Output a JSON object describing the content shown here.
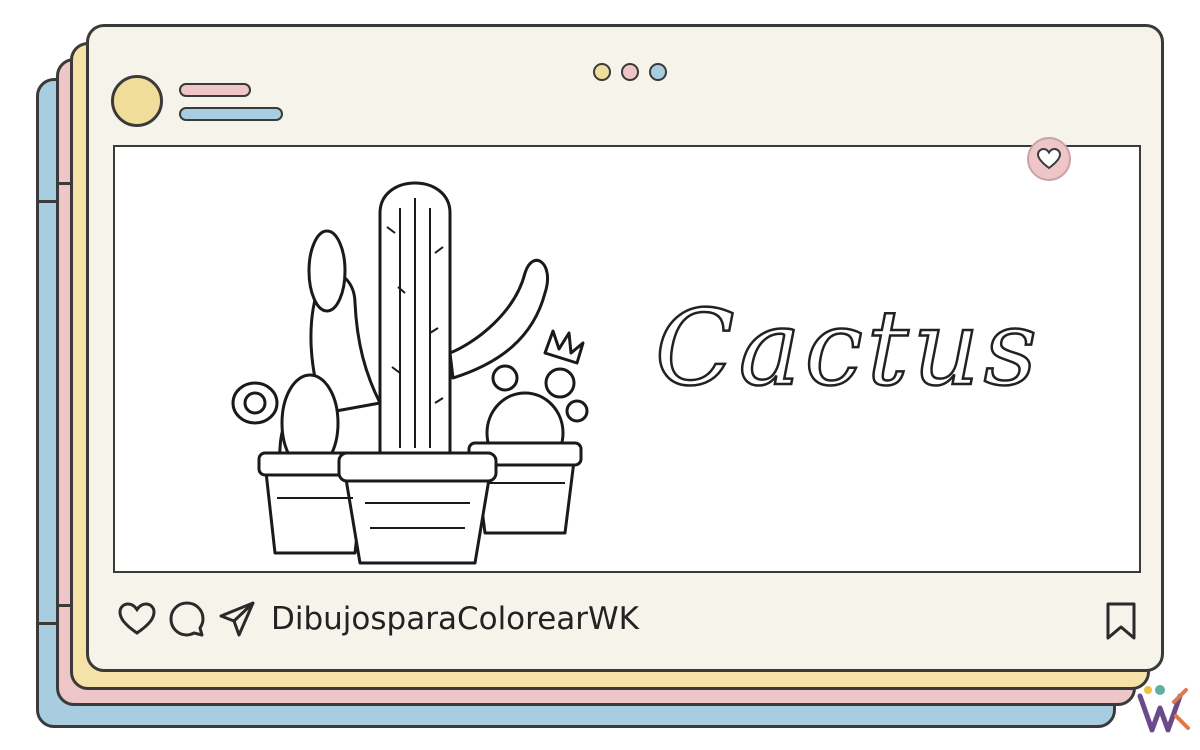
{
  "post": {
    "username": "DibujosparaColorearWK",
    "title_word": "Cactus"
  },
  "window_dots": [
    "#f1dd9a",
    "#efc6c8",
    "#a9cde0"
  ],
  "colors": {
    "blue_layer": "#a9cde0",
    "pink_layer": "#efc6c8",
    "yellow_layer": "#f5e2a8",
    "card": "#f6f3ea"
  },
  "icons": [
    "heart-icon",
    "comment-icon",
    "send-icon",
    "bookmark-icon",
    "heart-badge-icon"
  ],
  "watermark": {
    "text": "WK"
  }
}
